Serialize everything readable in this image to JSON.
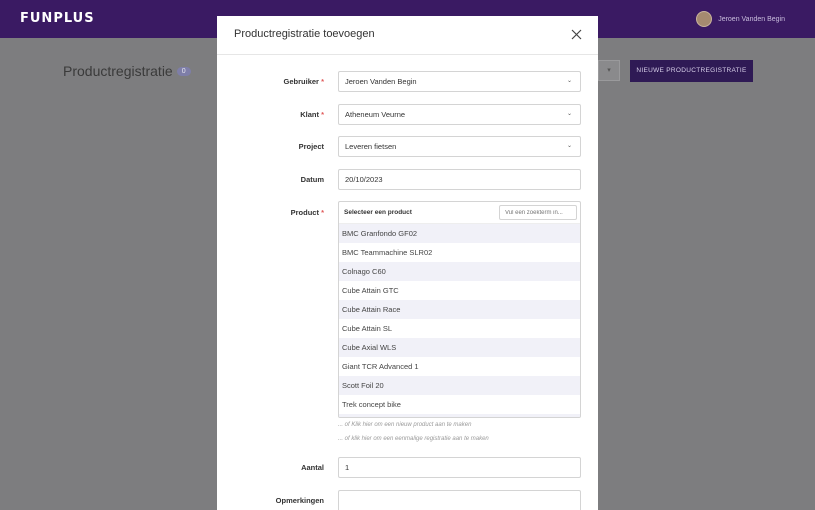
{
  "app": {
    "logo": "FUNPLUS",
    "user_name": "Jeroen Vanden Begin",
    "page_title": "Productregistratie",
    "page_count": "0",
    "new_button": "NIEUWE PRODUCTREGISTRATIE",
    "filter_chevron": "▾"
  },
  "modal": {
    "title": "Productregistratie toevoegen",
    "fields": {
      "gebruiker": {
        "label": "Gebruiker",
        "value": "Jeroen Vanden Begin"
      },
      "klant": {
        "label": "Klant",
        "value": "Atheneum Veurne"
      },
      "project": {
        "label": "Project",
        "value": "Leveren fietsen"
      },
      "datum": {
        "label": "Datum",
        "value": "20/10/2023"
      },
      "product": {
        "label": "Product",
        "header": "Selecteer een product",
        "search_placeholder": "Vul een zoekterm in...",
        "items": [
          "BMC Granfondo GF02",
          "BMC Teammachine SLR02",
          "Colnago C60",
          "Cube Attain GTC",
          "Cube Attain Race",
          "Cube Attain SL",
          "Cube Axial WLS",
          "Giant TCR Advanced 1",
          "Scott Foil 20",
          "Trek concept bike"
        ]
      },
      "aantal": {
        "label": "Aantal",
        "value": "1"
      },
      "opmerkingen": {
        "label": "Opmerkingen",
        "value": ""
      }
    },
    "hints": {
      "new_product": "... of Klik hier om een nieuw product aan te maken",
      "one_time": "... of klik hier om een eenmalige registratie aan te maken"
    },
    "required_mark": "*",
    "chevron": "⌄"
  },
  "colors": {
    "topbar": "#3a1a63",
    "accent_button": "#2f1a55",
    "required": "#e05a5a",
    "list_alt_row": "#f1f1f8"
  }
}
